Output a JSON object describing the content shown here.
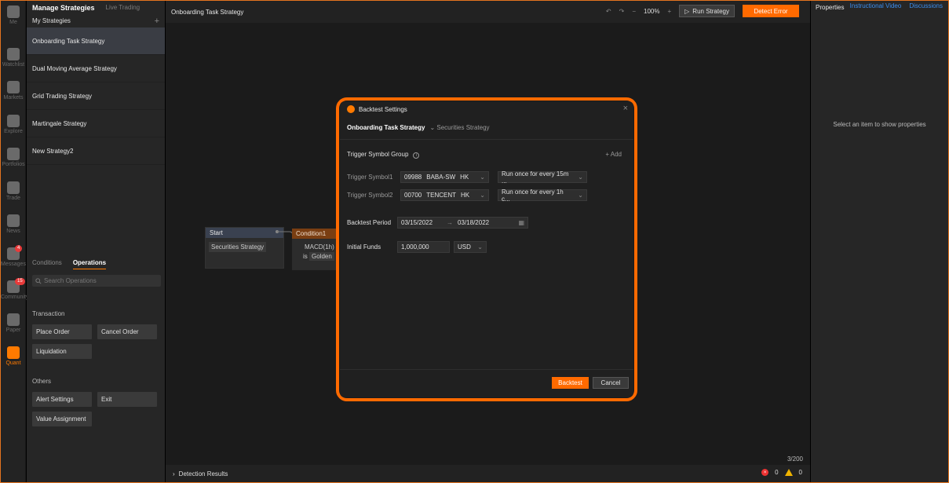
{
  "rail": [
    {
      "name": "me",
      "label": "Me"
    },
    {
      "name": "watchlist",
      "label": "Watchlist"
    },
    {
      "name": "markets",
      "label": "Markets"
    },
    {
      "name": "explore",
      "label": "Explore"
    },
    {
      "name": "portfolios",
      "label": "Portfolios"
    },
    {
      "name": "trade",
      "label": "Trade"
    },
    {
      "name": "news",
      "label": "News"
    },
    {
      "name": "messages",
      "label": "Messages",
      "badge": "4"
    },
    {
      "name": "community",
      "label": "Community",
      "badge": "15"
    },
    {
      "name": "paper",
      "label": "Paper"
    },
    {
      "name": "quant",
      "label": "Quant",
      "active": true
    }
  ],
  "strategies": {
    "title": "Manage Strategies",
    "tab_live": "Live Trading",
    "my_label": "My Strategies",
    "add_icon": "+",
    "items": [
      "Onboarding Task Strategy",
      "Dual Moving Average Strategy",
      "Grid Trading Strategy",
      "Martingale Strategy",
      "New Strategy2"
    ]
  },
  "ops": {
    "tab_conditions": "Conditions",
    "tab_operations": "Operations",
    "search_placeholder": "Search Operations",
    "transaction_title": "Transaction",
    "place_order": "Place Order",
    "cancel_order": "Cancel Order",
    "liquidation": "Liquidation",
    "others_title": "Others",
    "alert_settings": "Alert Settings",
    "exit": "Exit",
    "value_assignment": "Value Assignment"
  },
  "canvas": {
    "title": "Onboarding Task Strategy",
    "zoom": "100%",
    "run": "Run Strategy",
    "detect": "Detect Error",
    "start_node": "Start",
    "start_body": "Securities Strategy",
    "cond_node": "Condition1",
    "cond_r1": "MACD(1h)",
    "cond_r2_prefix": "is",
    "cond_r2_value": "Golden",
    "counter": "3/200",
    "detection": "Detection Results",
    "errors": "0",
    "warnings": "0"
  },
  "props": {
    "title": "Properties",
    "empty": "Select an item to show properties"
  },
  "top_links": {
    "video": "Instructional Video",
    "discussions": "Discussions"
  },
  "modal": {
    "title": "Backtest Settings",
    "strategy": "Onboarding Task Strategy",
    "strategy_chevron": "⌄",
    "strategy_type": "Securities Strategy",
    "trigger_group": "Trigger Symbol Group",
    "add": "+ Add",
    "sym1_label": "Trigger Symbol1",
    "sym1_code": "09988",
    "sym1_name": "BABA-SW",
    "sym1_mkt": "HK",
    "sym1_freq": "Run once for every 15m ...",
    "sym2_label": "Trigger Symbol2",
    "sym2_code": "00700",
    "sym2_name": "TENCENT",
    "sym2_mkt": "HK",
    "sym2_freq": "Run once for every 1h c...",
    "period_label": "Backtest Period",
    "date_from": "03/15/2022",
    "date_to": "03/18/2022",
    "funds_label": "Initial Funds",
    "funds": "1,000,000",
    "currency": "USD",
    "backtest": "Backtest",
    "cancel": "Cancel"
  }
}
